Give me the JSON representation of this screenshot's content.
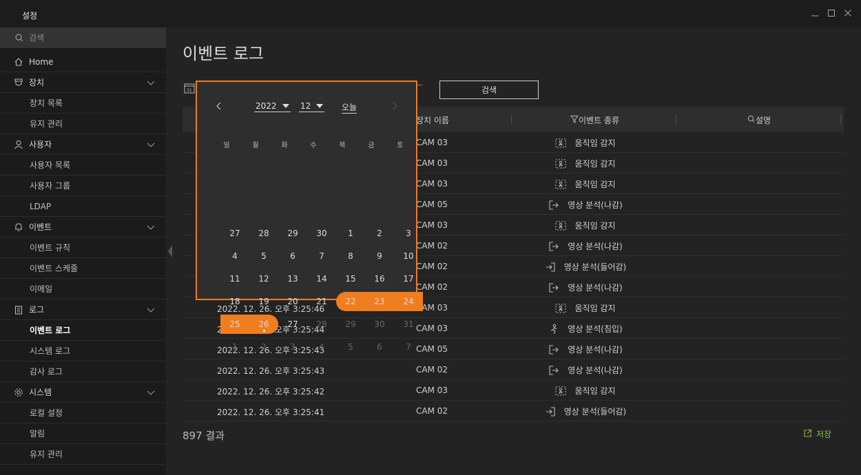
{
  "app": {
    "title": "설정"
  },
  "search": {
    "placeholder": "검색"
  },
  "sidebar": {
    "home": "Home",
    "sections": [
      {
        "label": "장치",
        "icon": "device-icon",
        "items": [
          "장치 목록",
          "유지 관리"
        ]
      },
      {
        "label": "사용자",
        "icon": "user-icon",
        "items": [
          "사용자 목록",
          "사용자 그룹",
          "LDAP"
        ]
      },
      {
        "label": "이벤트",
        "icon": "bell-icon",
        "items": [
          "이벤트 규칙",
          "이벤트 스케줄",
          "이메일"
        ]
      },
      {
        "label": "로그",
        "icon": "clipboard-icon",
        "items": [
          "이벤트 로그",
          "시스템 로그",
          "감사 로그"
        ]
      },
      {
        "label": "시스템",
        "icon": "gear-icon",
        "items": [
          "로컬 설정",
          "알림",
          "유지 관리"
        ]
      }
    ],
    "active_item": "이벤트 로그"
  },
  "main": {
    "title": "이벤트 로그",
    "search_button": "검색",
    "columns": {
      "device": "장치 이름",
      "event": "이벤트 종류",
      "description": "설명"
    },
    "rows": [
      {
        "time": "",
        "device": "CAM 03",
        "event": "움직임 감지",
        "icon": "motion-icon"
      },
      {
        "time": "",
        "device": "CAM 03",
        "event": "움직임 감지",
        "icon": "motion-icon"
      },
      {
        "time": "",
        "device": "CAM 03",
        "event": "움직임 감지",
        "icon": "motion-icon"
      },
      {
        "time": "",
        "device": "CAM 05",
        "event": "영상 분석(나감)",
        "icon": "exit-icon"
      },
      {
        "time": "",
        "device": "CAM 03",
        "event": "움직임 감지",
        "icon": "motion-icon"
      },
      {
        "time": "",
        "device": "CAM 02",
        "event": "영상 분석(나감)",
        "icon": "exit-icon"
      },
      {
        "time": "",
        "device": "CAM 02",
        "event": "영상 분석(들어감)",
        "icon": "enter-icon"
      },
      {
        "time": "",
        "device": "CAM 02",
        "event": "영상 분석(나감)",
        "icon": "exit-icon"
      },
      {
        "time": "2022. 12. 26. 오후 3:25:46",
        "device": "CAM 03",
        "event": "움직임 감지",
        "icon": "motion-icon"
      },
      {
        "time": "2022. 12. 26. 오후 3:25:44",
        "device": "CAM 03",
        "event": "영상 분석(침입)",
        "icon": "intrusion-icon"
      },
      {
        "time": "2022. 12. 26. 오후 3:25:43",
        "device": "CAM 05",
        "event": "영상 분석(나감)",
        "icon": "exit-icon"
      },
      {
        "time": "2022. 12. 26. 오후 3:25:43",
        "device": "CAM 02",
        "event": "영상 분석(나감)",
        "icon": "exit-icon"
      },
      {
        "time": "2022. 12. 26. 오후 3:25:42",
        "device": "CAM 03",
        "event": "움직임 감지",
        "icon": "motion-icon"
      },
      {
        "time": "2022. 12. 26. 오후 3:25:41",
        "device": "CAM 02",
        "event": "영상 분석(들어감)",
        "icon": "enter-icon"
      }
    ],
    "results": "897 결과",
    "save": "저장"
  },
  "calendar": {
    "year": "2022",
    "month": "12",
    "today_label": "오늘",
    "weekdays": [
      "일",
      "월",
      "화",
      "수",
      "목",
      "금",
      "토"
    ],
    "weeks": [
      [
        "27",
        "28",
        "29",
        "30",
        "1",
        "2",
        "3"
      ],
      [
        "4",
        "5",
        "6",
        "7",
        "8",
        "9",
        "10"
      ],
      [
        "11",
        "12",
        "13",
        "14",
        "15",
        "16",
        "17"
      ],
      [
        "18",
        "19",
        "20",
        "21",
        "22",
        "23",
        "24"
      ],
      [
        "25",
        "26",
        "27",
        "28",
        "29",
        "30",
        "31"
      ],
      [
        "1",
        "2",
        "3",
        "4",
        "5",
        "6",
        "7"
      ]
    ],
    "selected_range": [
      "22",
      "26"
    ],
    "today": "26",
    "accent_color": "#f07d1e"
  }
}
